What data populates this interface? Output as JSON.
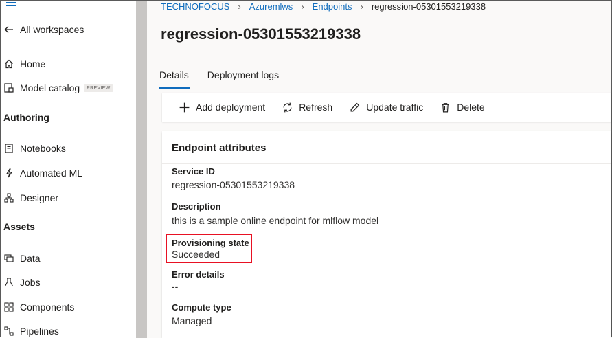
{
  "sidebar": {
    "back_label": "All workspaces",
    "items": [
      {
        "label": "Home",
        "icon": "home-icon"
      },
      {
        "label": "Model catalog",
        "icon": "model-catalog-icon",
        "badge": "PREVIEW"
      }
    ],
    "sections": [
      {
        "title": "Authoring",
        "items": [
          {
            "label": "Notebooks",
            "icon": "notebook-icon"
          },
          {
            "label": "Automated ML",
            "icon": "automated-ml-icon"
          },
          {
            "label": "Designer",
            "icon": "designer-icon"
          }
        ]
      },
      {
        "title": "Assets",
        "items": [
          {
            "label": "Data",
            "icon": "data-icon"
          },
          {
            "label": "Jobs",
            "icon": "jobs-icon"
          },
          {
            "label": "Components",
            "icon": "components-icon"
          },
          {
            "label": "Pipelines",
            "icon": "pipelines-icon"
          }
        ]
      }
    ]
  },
  "breadcrumb": [
    "TECHNOFOCUS",
    "Azuremlws",
    "Endpoints",
    "regression-05301553219338"
  ],
  "page_title": "regression-05301553219338",
  "tabs": [
    {
      "label": "Details",
      "active": true
    },
    {
      "label": "Deployment logs",
      "active": false
    }
  ],
  "toolbar": {
    "add_deployment": "Add deployment",
    "refresh": "Refresh",
    "update_traffic": "Update traffic",
    "delete": "Delete"
  },
  "card": {
    "title": "Endpoint attributes",
    "attributes": [
      {
        "label": "Service ID",
        "value": "regression-05301553219338"
      },
      {
        "label": "Description",
        "value": "this is a sample online endpoint for mlflow model"
      },
      {
        "label": "Provisioning state",
        "value": "Succeeded"
      },
      {
        "label": "Error details",
        "value": "--"
      },
      {
        "label": "Compute type",
        "value": "Managed"
      }
    ]
  },
  "colors": {
    "accent": "#0f6cbd",
    "highlight": "#e81123"
  }
}
